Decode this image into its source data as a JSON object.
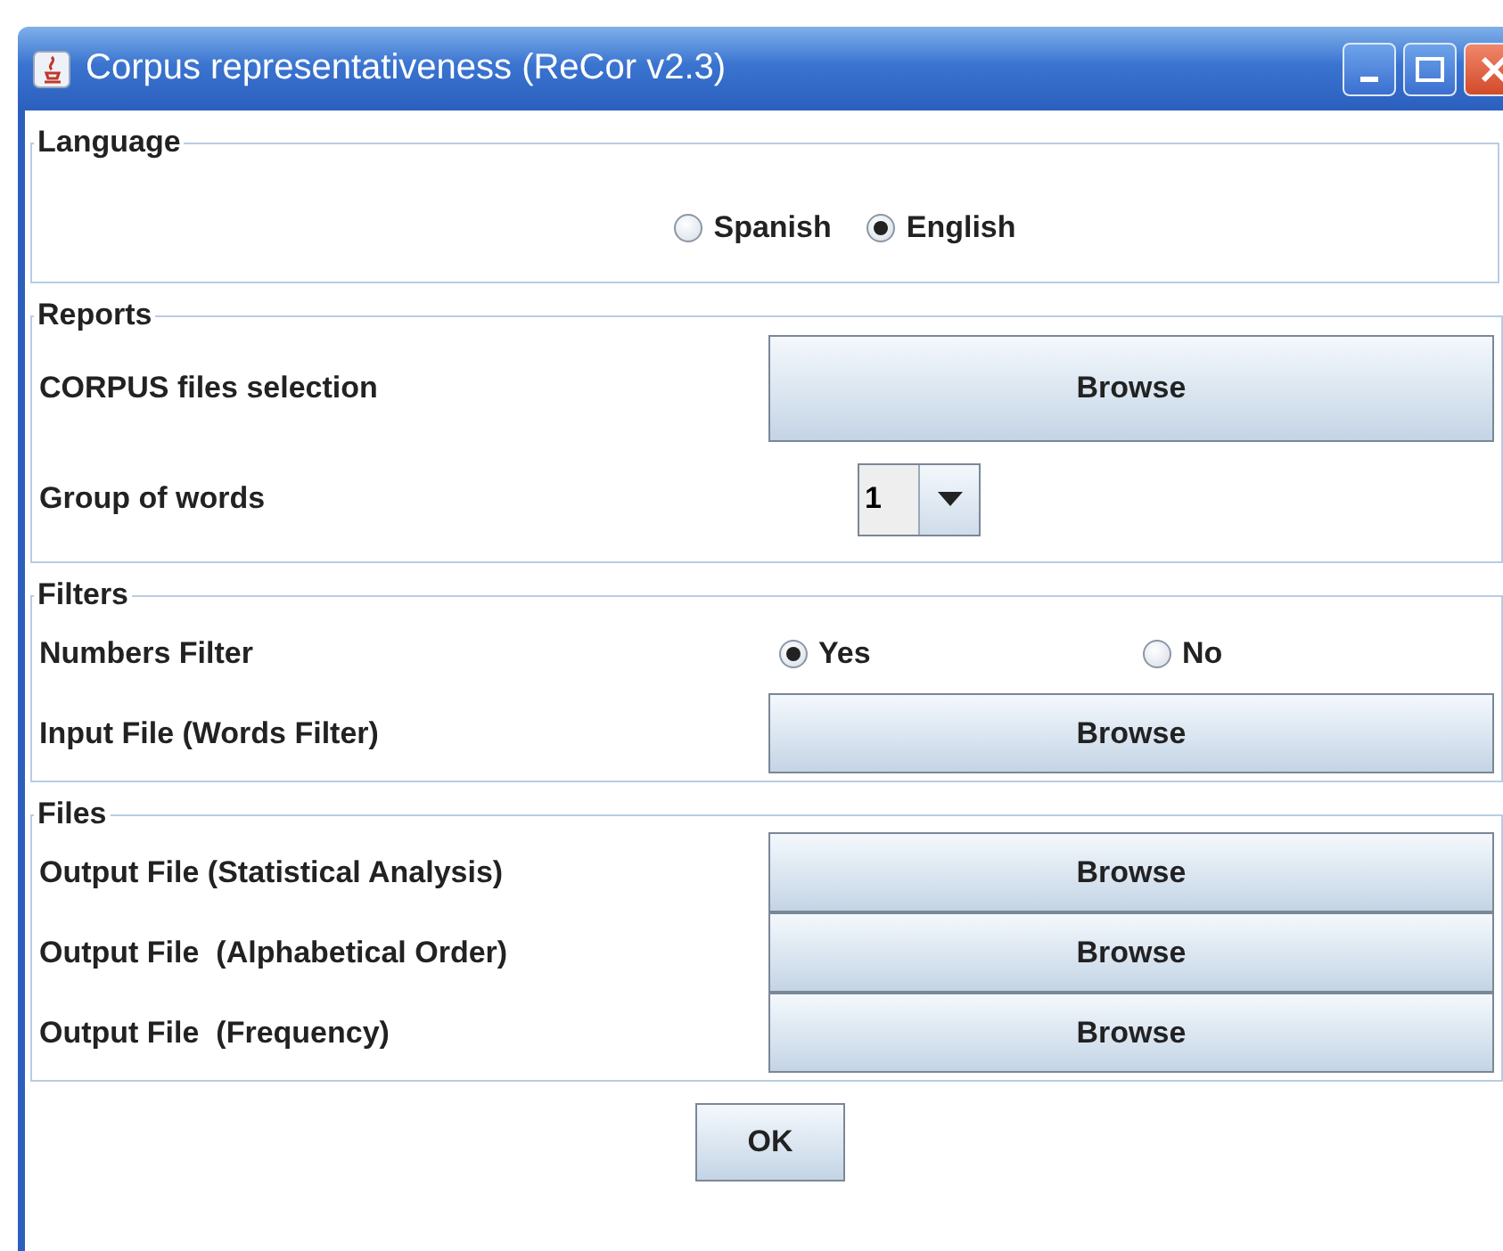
{
  "window": {
    "title": "Corpus representativeness (ReCor v2.3)"
  },
  "sections": [
    {
      "legend": "Language",
      "rows": [
        {
          "kind": "radios",
          "options": [
            {
              "label": "Spanish",
              "selected": false
            },
            {
              "label": "English",
              "selected": true
            }
          ]
        }
      ]
    },
    {
      "legend": "Reports",
      "rows": [
        {
          "kind": "button",
          "label": "CORPUS files selection",
          "button": "Browse"
        },
        {
          "kind": "combo",
          "label": "Group of words",
          "value": "1"
        }
      ]
    },
    {
      "legend": "Filters",
      "rows": [
        {
          "kind": "radio_pair",
          "label": "Numbers Filter",
          "options": [
            {
              "label": "Yes",
              "selected": true
            },
            {
              "label": "No",
              "selected": false
            }
          ]
        },
        {
          "kind": "button",
          "label": "Input File (Words Filter)",
          "button": "Browse"
        }
      ]
    },
    {
      "legend": "Files",
      "rows": [
        {
          "kind": "button",
          "label": "Output File (Statistical Analysis)",
          "button": "Browse"
        },
        {
          "kind": "button",
          "label": "Output File  (Alphabetical Order)",
          "button": "Browse"
        },
        {
          "kind": "button",
          "label": "Output File  (Frequency)",
          "button": "Browse"
        }
      ]
    }
  ],
  "ok_button": "OK"
}
